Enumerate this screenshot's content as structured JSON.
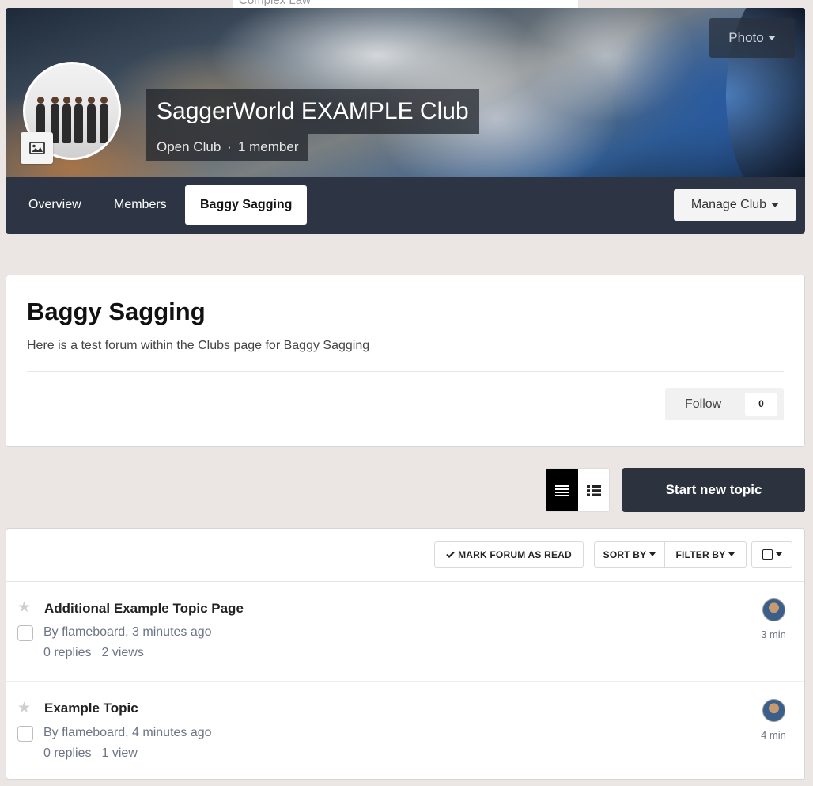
{
  "top_ghost_text": "Complex Law",
  "club": {
    "name": "SaggerWorld EXAMPLE Club",
    "type": "Open Club",
    "separator": "·",
    "members": "1 member",
    "photo_button": "Photo"
  },
  "nav": {
    "tabs": [
      {
        "label": "Overview",
        "active": false
      },
      {
        "label": "Members",
        "active": false
      },
      {
        "label": "Baggy Sagging",
        "active": true
      }
    ],
    "manage_label": "Manage Club"
  },
  "forum": {
    "title": "Baggy Sagging",
    "description": "Here is a test forum within the Clubs page for Baggy Sagging",
    "follow_label": "Follow",
    "follow_count": "0"
  },
  "actions": {
    "start_topic": "Start new topic"
  },
  "toolbar": {
    "mark_read": "MARK FORUM AS READ",
    "sort_by": "SORT BY",
    "filter_by": "FILTER BY"
  },
  "topics": [
    {
      "title": "Additional Example Topic Page",
      "by": "By flameboard, 3 minutes ago",
      "replies": "0 replies",
      "views": "2 views",
      "last": "3 min"
    },
    {
      "title": "Example Topic",
      "by": "By flameboard, 4 minutes ago",
      "replies": "0 replies",
      "views": "1 view",
      "last": "4 min"
    }
  ],
  "colors": {
    "page_bg": "#ebe5e4",
    "header_bar": "#2d3444",
    "primary_button": "#2d323f",
    "meta_text": "#6c7485"
  },
  "icons": [
    "image-icon",
    "caret-down-icon",
    "table-view-icon",
    "list-view-icon",
    "checkmark-icon",
    "checkbox-icon",
    "star-icon"
  ]
}
